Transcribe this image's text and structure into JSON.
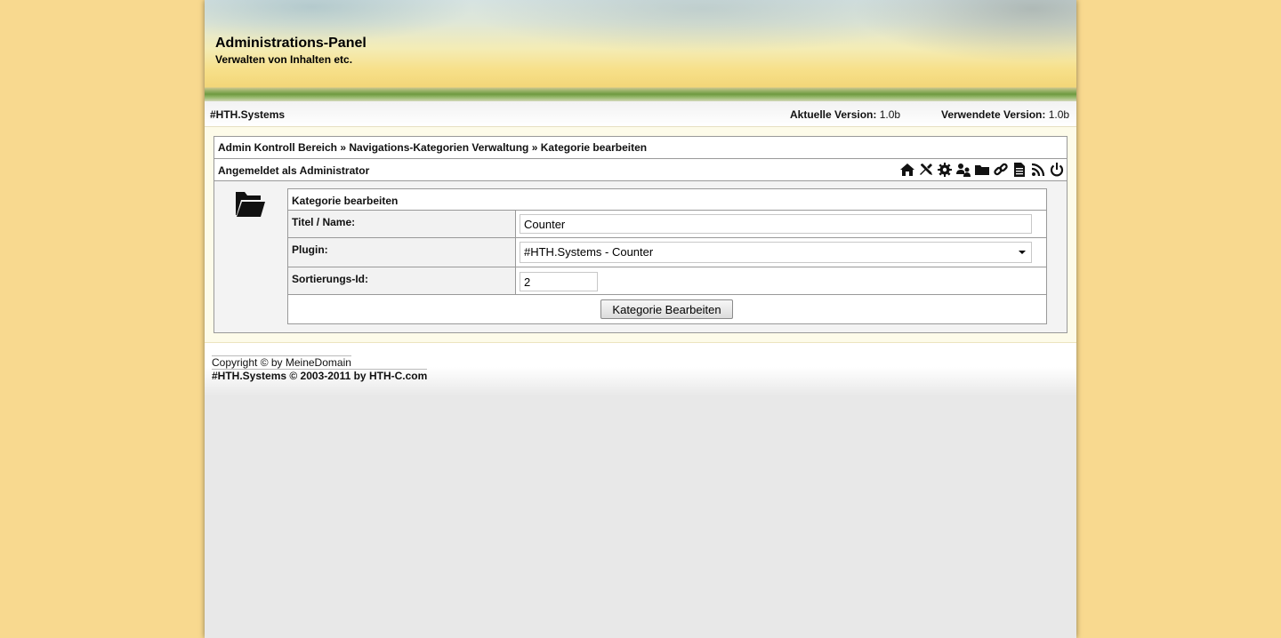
{
  "header": {
    "title": "Administrations-Panel",
    "subtitle": "Verwalten von Inhalten etc."
  },
  "infobar": {
    "brand": "#HTH.Systems",
    "current_version_label": "Aktuelle Version:",
    "current_version_value": "1.0b",
    "used_version_label": "Verwendete Version:",
    "used_version_value": "1.0b"
  },
  "breadcrumb": "Admin Kontroll Bereich » Navigations-Kategorien Verwaltung » Kategorie bearbeiten",
  "logged_in": "Angemeldet als Administrator",
  "toolbar_icons": [
    "home-icon",
    "tools-icon",
    "settings-icon",
    "users-icon",
    "folder-icon",
    "link-icon",
    "document-icon",
    "rss-icon",
    "power-icon"
  ],
  "form": {
    "heading": "Kategorie bearbeiten",
    "title_label": "Titel / Name:",
    "title_value": "Counter",
    "plugin_label": "Plugin:",
    "plugin_value": "#HTH.Systems - Counter",
    "sort_label": "Sortierungs-Id:",
    "sort_value": "2",
    "submit_label": "Kategorie Bearbeiten"
  },
  "footer": {
    "copyright": "Copyright © by MeineDomain",
    "credit": "#HTH.Systems © 2003-2011 by HTH-C.com"
  },
  "colors": {
    "page_background": "#f8d98f",
    "content_background": "#fdfbe9"
  }
}
